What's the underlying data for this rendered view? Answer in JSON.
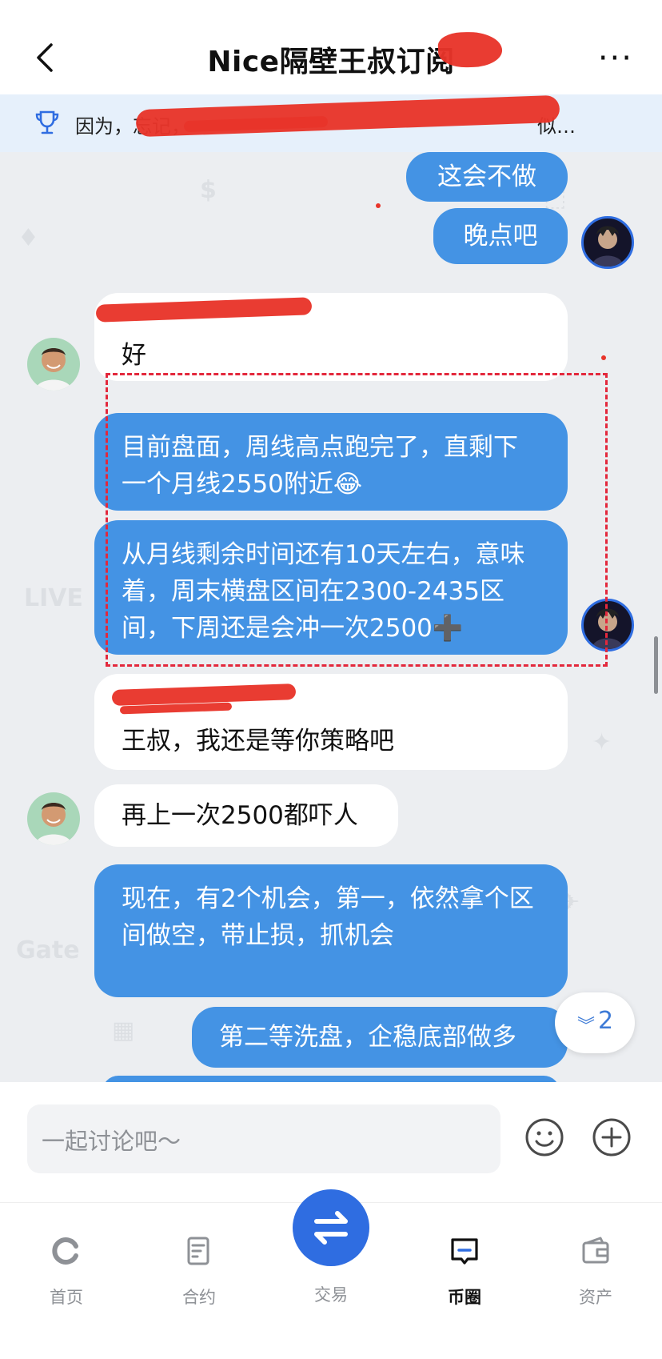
{
  "header": {
    "title": "Nice隔壁王叔订阅",
    "back_icon": "chevron-left-icon",
    "more_icon": "more-horizontal-icon"
  },
  "notice": {
    "icon": "trophy-icon",
    "text": "因为，忘记，",
    "tail": "似…"
  },
  "messages": [
    {
      "side": "right",
      "text": "这会不做"
    },
    {
      "side": "right",
      "text": "晚点吧"
    },
    {
      "side": "left",
      "text": "好"
    },
    {
      "side": "right",
      "text": "目前盘面，周线高点跑完了，直剩下一个月线2550附近😂"
    },
    {
      "side": "right",
      "text": "从月线剩余时间还有10天左右，意味着，周末横盘区间在2300-2435区间，下周还是会冲一次2500➕"
    },
    {
      "side": "left",
      "text": "王叔，我还是等你策略吧"
    },
    {
      "side": "left",
      "text": "再上一次2500都吓人"
    },
    {
      "side": "right",
      "text": "现在，有2个机会，第一，依然拿个区间做空，带止损，抓机会"
    },
    {
      "side": "right",
      "text": "第二等洗盘，企稳底部做多"
    }
  ],
  "unread_count": "2",
  "input": {
    "placeholder": "一起讨论吧～",
    "emoji_icon": "smile-icon",
    "plus_icon": "plus-circle-icon"
  },
  "tabs": [
    {
      "label": "首页",
      "icon": "home-icon"
    },
    {
      "label": "合约",
      "icon": "contract-icon"
    },
    {
      "label": "交易",
      "icon": "swap-icon"
    },
    {
      "label": "币圈",
      "icon": "chat-square-icon",
      "active": true
    },
    {
      "label": "资产",
      "icon": "wallet-icon"
    }
  ],
  "colors": {
    "accent": "#2f6de1",
    "bubble_blue": "#4493e4",
    "redaction": "#e8342a"
  }
}
